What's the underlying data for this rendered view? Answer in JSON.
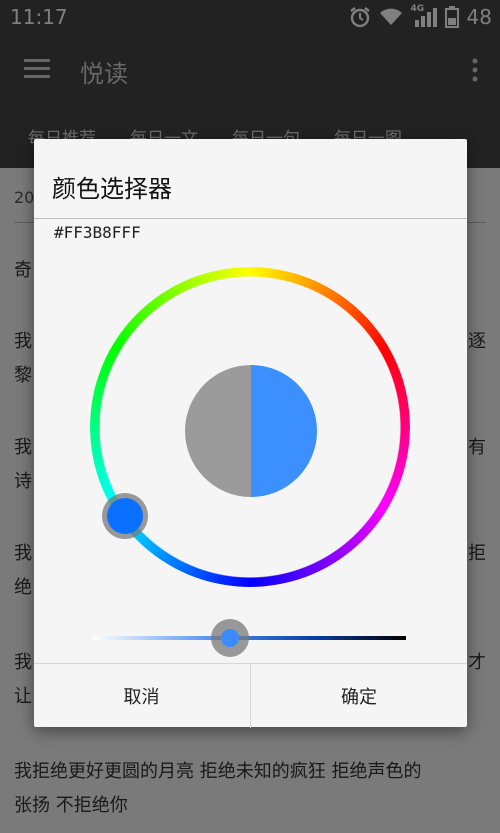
{
  "status_bar": {
    "time": "11:17",
    "network_label": "4G",
    "battery": "48"
  },
  "app_bar": {
    "title": "悦读"
  },
  "tabs": [
    "每日推荐",
    "每日一文",
    "每日一句",
    "每日一图"
  ],
  "article": {
    "date_fragment": "20",
    "paragraphs": [
      {
        "line1": "奇",
        "line1_right": ""
      },
      {
        "line1": "我",
        "line1_right": "逐",
        "line2": "黎"
      },
      {
        "line1": "我",
        "line1_right": "有",
        "line2": "诗"
      },
      {
        "line1": "我",
        "line1_right": "拒",
        "line2": "绝"
      },
      {
        "line1": "我",
        "line1_right": "才",
        "line2": "让"
      }
    ],
    "visible_paragraph": {
      "line1": "我拒绝更好更圆的月亮 拒绝未知的疯狂 拒绝声色的",
      "line2": "张扬 不拒绝你"
    }
  },
  "dialog": {
    "title": "颜色选择器",
    "hex_value": "#FF3B8FFF",
    "old_color": "#9b9b9b",
    "new_color": "#3b8fff",
    "hue_knob_color": "#0b6fff",
    "slider_value_fraction": 0.44,
    "cancel_label": "取消",
    "ok_label": "确定"
  }
}
